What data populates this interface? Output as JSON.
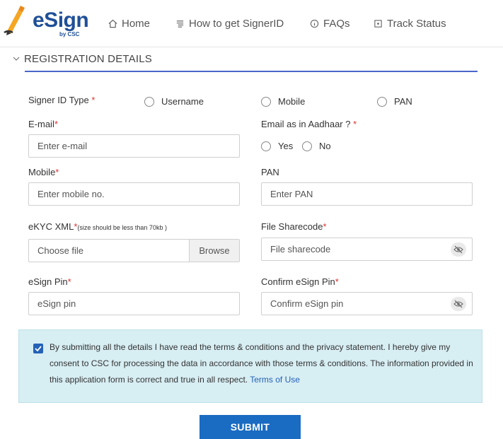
{
  "brand": {
    "name": "eSign",
    "sub": "by CSC"
  },
  "nav": {
    "home": "Home",
    "how_to": "How to get SignerID",
    "faqs": "FAQs",
    "track": "Track Status"
  },
  "section": {
    "title": "REGISTRATION DETAILS"
  },
  "form": {
    "signer_type": {
      "label": "Signer ID Type",
      "options": [
        "Username",
        "Mobile",
        "PAN"
      ]
    },
    "email": {
      "label": "E-mail",
      "placeholder": "Enter e-mail"
    },
    "email_aadhaar": {
      "label": "Email as in Aadhaar ?",
      "options": [
        "Yes",
        "No"
      ]
    },
    "mobile": {
      "label": "Mobile",
      "placeholder": "Enter mobile no."
    },
    "pan": {
      "label": "PAN",
      "placeholder": "Enter PAN"
    },
    "ekyc": {
      "label": "eKYC XML",
      "note": "(size should be less than 70kb )",
      "placeholder": "Choose file",
      "browse": "Browse"
    },
    "sharecode": {
      "label": "File Sharecode",
      "placeholder": "File sharecode"
    },
    "pin": {
      "label": "eSign Pin",
      "placeholder": "eSign pin"
    },
    "confirm_pin": {
      "label": "Confirm eSign Pin",
      "placeholder": "Confirm eSign pin"
    },
    "required_mark": "*"
  },
  "consent": {
    "checked": true,
    "text": "By submitting all the details I have read the terms & conditions and the privacy statement. I hereby give my consent to CSC for processing the data in accordance with those terms & conditions. The information provided in this application form is correct and true in all respect.",
    "link": "Terms of Use"
  },
  "submit_label": "SUBMIT",
  "colors": {
    "brand": "#1f4f97",
    "accent": "#2462b8",
    "button": "#1a6bc2",
    "consent_bg": "#d7eef3",
    "required": "#dd3333"
  }
}
